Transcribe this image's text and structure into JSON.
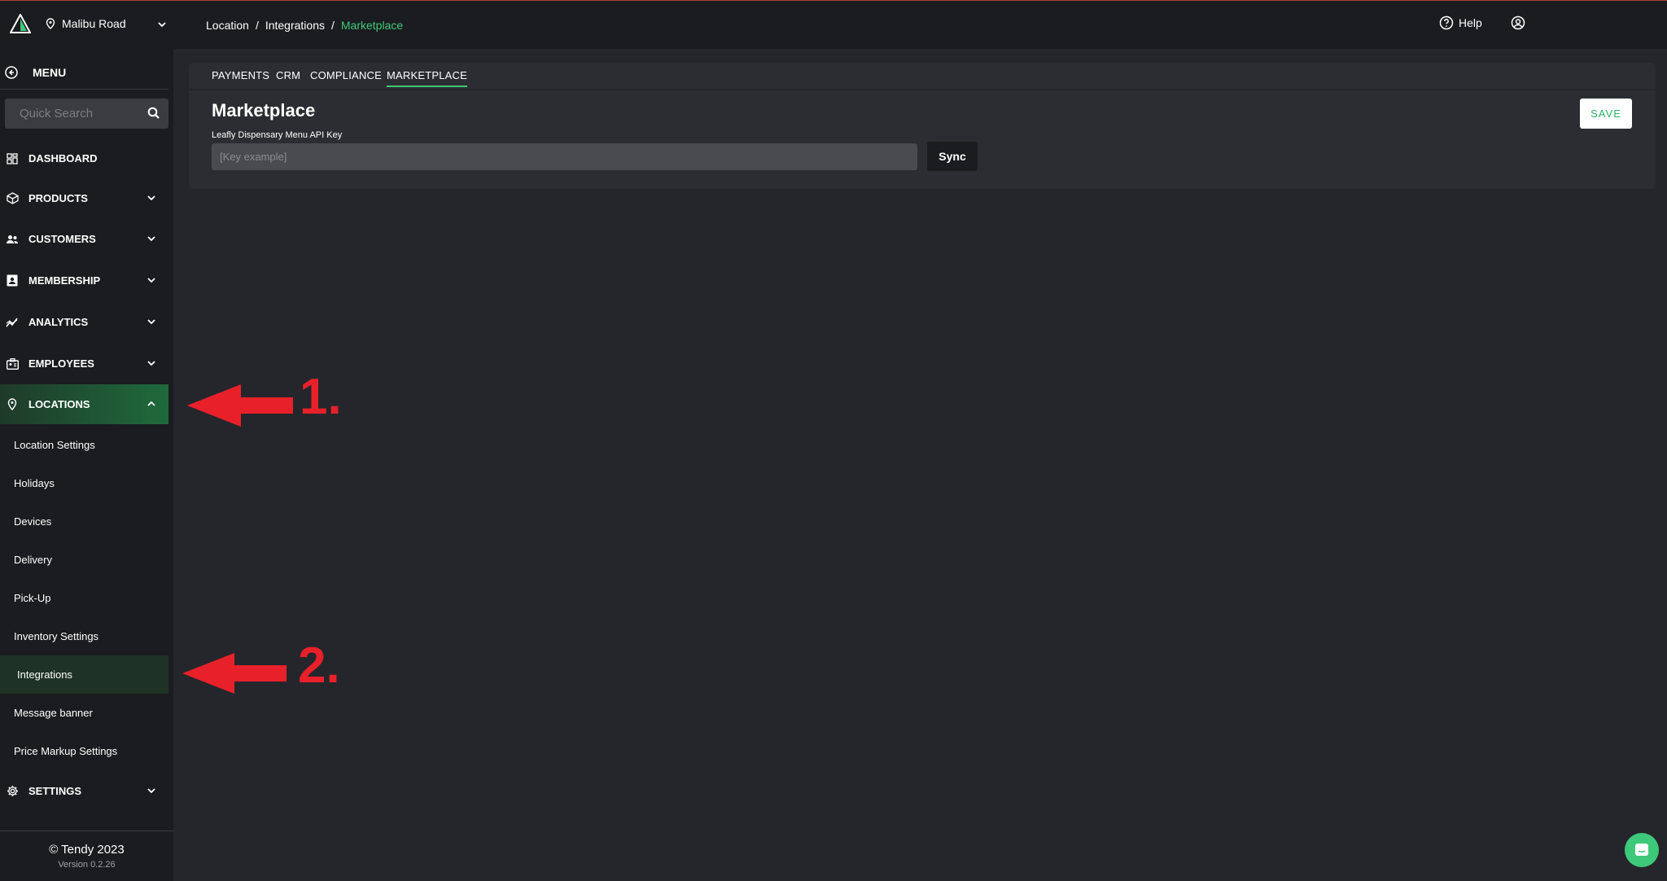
{
  "header": {
    "location_name": "Malibu Road",
    "breadcrumb": [
      "Location",
      "Integrations",
      "Marketplace"
    ],
    "help_label": "Help"
  },
  "sidebar": {
    "menu_label": "MENU",
    "search_placeholder": "Quick Search",
    "items": [
      {
        "label": "DASHBOARD",
        "icon": "dashboard-icon"
      },
      {
        "label": "PRODUCTS",
        "icon": "box-icon"
      },
      {
        "label": "CUSTOMERS",
        "icon": "people-icon"
      },
      {
        "label": "MEMBERSHIP",
        "icon": "id-card-icon"
      },
      {
        "label": "ANALYTICS",
        "icon": "chart-icon"
      },
      {
        "label": "EMPLOYEES",
        "icon": "badge-icon"
      },
      {
        "label": "LOCATIONS",
        "icon": "pin-icon"
      }
    ],
    "sub_items": [
      "Location Settings",
      "Holidays",
      "Devices",
      "Delivery",
      "Pick-Up",
      "Inventory Settings",
      "Integrations",
      "Message banner",
      "Price Markup Settings"
    ],
    "settings_label": "SETTINGS",
    "footer_copyright": "© Tendy 2023",
    "footer_version": "Version 0.2.26"
  },
  "tabs": [
    "PAYMENTS",
    "CRM",
    "COMPLIANCE",
    "MARKETPLACE"
  ],
  "active_tab": "MARKETPLACE",
  "panel": {
    "title": "Marketplace",
    "field_label": "Leafly Dispensary Menu API Key",
    "field_placeholder": "[Key example]",
    "sync_label": "Sync",
    "save_label": "SAVE"
  },
  "annotations": {
    "one": "1.",
    "two": "2."
  },
  "colors": {
    "accent": "#3ec97a",
    "annotation": "#e8202a",
    "background": "#25262b",
    "sidebar": "#1b1c1f"
  }
}
